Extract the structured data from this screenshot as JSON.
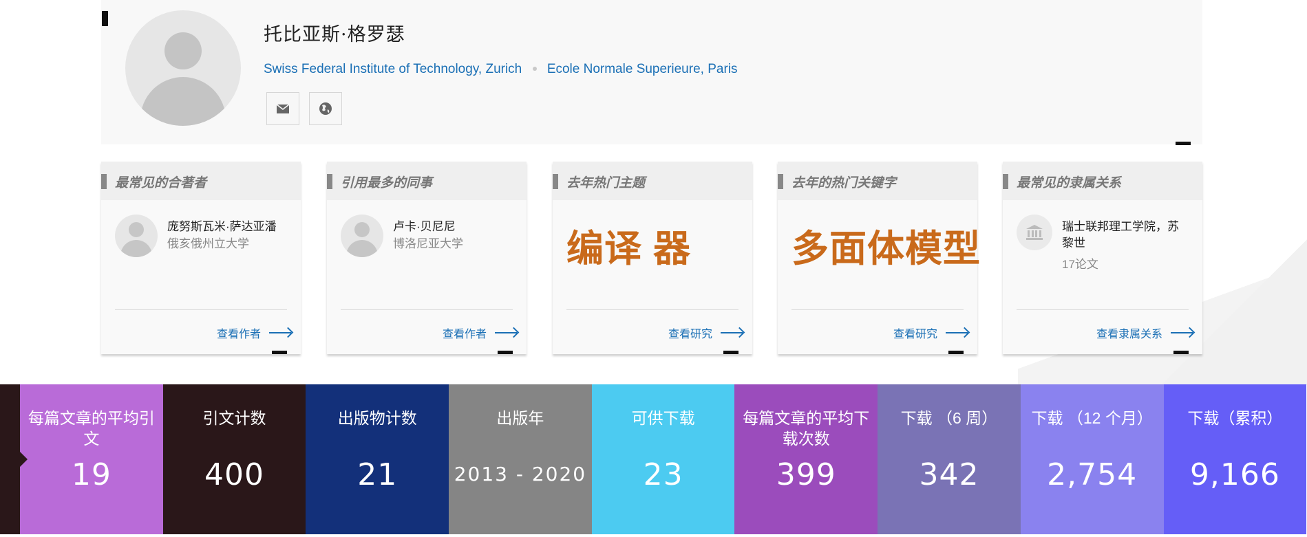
{
  "profile": {
    "name": "托比亚斯·格罗瑟",
    "affiliations": [
      "Swiss Federal Institute of Technology, Zurich",
      "Ecole Normale Superieure, Paris"
    ],
    "icons": [
      "email-icon",
      "globe-icon"
    ]
  },
  "cards": [
    {
      "title": "最常见的合著者",
      "name": "庞努斯瓦米·萨达亚潘",
      "sub": "俄亥俄州立大学",
      "link": "查看作者"
    },
    {
      "title": "引用最多的同事",
      "name": "卢卡·贝尼尼",
      "sub": "博洛尼亚大学",
      "link": "查看作者"
    },
    {
      "title": "去年热门主题",
      "topic": "编译 器",
      "link": "查看研究"
    },
    {
      "title": "去年的热门关键字",
      "topic": "多面体模型",
      "link": "查看研究"
    },
    {
      "title": "最常见的隶属关系",
      "name": "瑞士联邦理工学院，苏黎世",
      "sub": "17论文",
      "link": "查看隶属关系"
    }
  ],
  "stats": [
    {
      "label": "每篇文章的平均引文",
      "value": "19",
      "color": "#b96bd8"
    },
    {
      "label": "引文计数",
      "value": "400",
      "color": "#2a1719"
    },
    {
      "label": "出版物计数",
      "value": "21",
      "color": "#13307a"
    },
    {
      "label": "出版年",
      "value": "2013 - 2020",
      "color": "#858585"
    },
    {
      "label": "可供下载",
      "value": "23",
      "color": "#4ccbf1"
    },
    {
      "label": "每篇文章的平均下载次数",
      "value": "399",
      "color": "#9b4cbc"
    },
    {
      "label": "下载 （6 周）",
      "value": "342",
      "color": "#7a73b5"
    },
    {
      "label": "下载 （12 个月）",
      "value": "2,754",
      "color": "#8a82ef"
    },
    {
      "label": "下载（累积）",
      "value": "9,166",
      "color": "#655ef7"
    }
  ],
  "colors": {
    "link": "#1a6fb5",
    "topic": "#c96a1b"
  }
}
